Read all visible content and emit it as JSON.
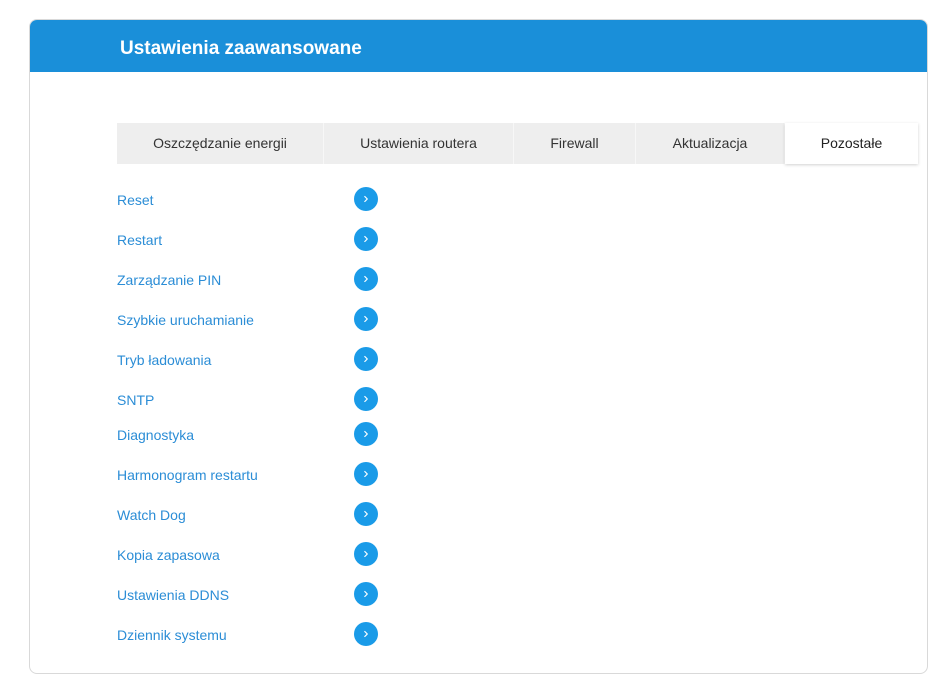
{
  "header": {
    "title": "Ustawienia zaawansowane"
  },
  "tabs": [
    {
      "label": "Oszczędzanie energii",
      "active": false
    },
    {
      "label": "Ustawienia routera",
      "active": false
    },
    {
      "label": "Firewall",
      "active": false
    },
    {
      "label": "Aktualizacja",
      "active": false
    },
    {
      "label": "Pozostałe",
      "active": true
    }
  ],
  "menu": {
    "items": [
      {
        "label": "Reset",
        "icon": "chevron-right-icon"
      },
      {
        "label": "Restart",
        "icon": "chevron-right-icon"
      },
      {
        "label": "Zarządzanie PIN",
        "icon": "chevron-right-icon"
      },
      {
        "label": "Szybkie uruchamianie",
        "icon": "chevron-right-icon"
      },
      {
        "label": "Tryb ładowania",
        "icon": "chevron-right-icon"
      },
      {
        "label": "SNTP",
        "icon": "chevron-right-icon"
      },
      {
        "label": "Diagnostyka",
        "icon": "chevron-right-icon"
      },
      {
        "label": "Harmonogram restartu",
        "icon": "chevron-right-icon"
      },
      {
        "label": "Watch Dog",
        "icon": "chevron-right-icon"
      },
      {
        "label": "Kopia zapasowa",
        "icon": "chevron-right-icon"
      },
      {
        "label": "Ustawienia DDNS",
        "icon": "chevron-right-icon"
      },
      {
        "label": "Dziennik systemu",
        "icon": "chevron-right-icon"
      }
    ]
  },
  "colors": {
    "header_bg": "#1a8fd9",
    "link": "#2b8dd6",
    "arrow_bg": "#1a9be8",
    "tab_bg": "#eeeeee"
  }
}
